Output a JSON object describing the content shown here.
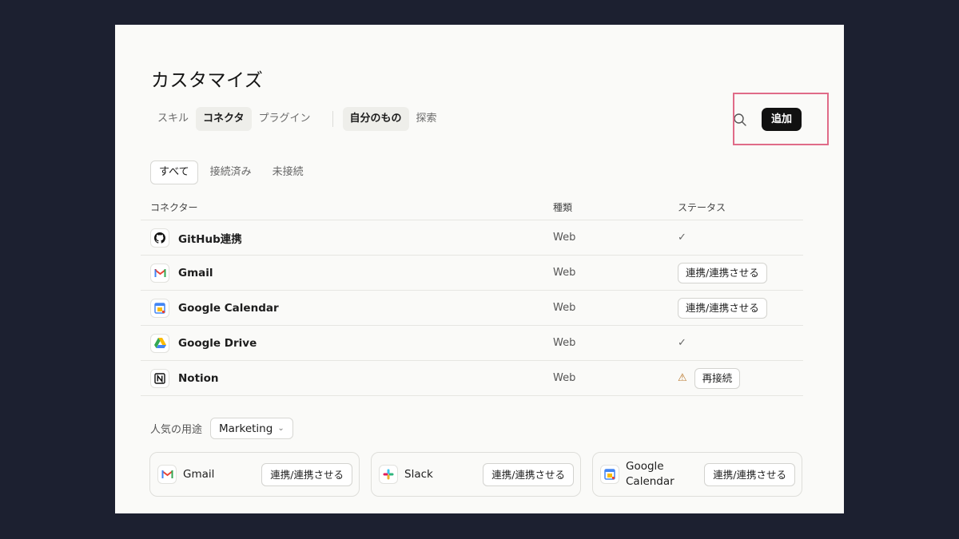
{
  "page": {
    "title": "カスタマイズ",
    "tabs": [
      {
        "label": "スキル",
        "active": false
      },
      {
        "label": "コネクタ",
        "active": true
      },
      {
        "label": "プラグイン",
        "active": false
      }
    ],
    "scope_tabs": [
      {
        "label": "自分のもの",
        "active": true
      },
      {
        "label": "探索",
        "active": false
      }
    ],
    "search_icon": "search-icon",
    "add_label": "追加",
    "highlight_color": "#e06b88"
  },
  "filters": [
    {
      "label": "すべて",
      "active": true
    },
    {
      "label": "接続済み",
      "active": false
    },
    {
      "label": "未接続",
      "active": false
    }
  ],
  "table": {
    "headers": {
      "name": "コネクター",
      "type": "種類",
      "status": "ステータス"
    },
    "rows": [
      {
        "name": "GitHub連携",
        "icon": "github-icon",
        "type": "Web",
        "status": "connected",
        "status_glyph": "✓"
      },
      {
        "name": "Gmail",
        "icon": "gmail-icon",
        "type": "Web",
        "status": "action",
        "action_label": "連携/連携させる"
      },
      {
        "name": "Google Calendar",
        "icon": "google-calendar-icon",
        "type": "Web",
        "status": "action",
        "action_label": "連携/連携させる"
      },
      {
        "name": "Google Drive",
        "icon": "google-drive-icon",
        "type": "Web",
        "status": "connected",
        "status_glyph": "✓"
      },
      {
        "name": "Notion",
        "icon": "notion-icon",
        "type": "Web",
        "status": "warning",
        "warning_glyph": "⚠",
        "action_label": "再接続"
      }
    ]
  },
  "popular": {
    "label": "人気の用途",
    "selected": "Marketing",
    "cards": [
      {
        "name": "Gmail",
        "icon": "gmail-icon",
        "action_label": "連携/連携させる"
      },
      {
        "name": "Slack",
        "icon": "slack-icon",
        "action_label": "連携/連携させる"
      },
      {
        "name": "Google\nCalendar",
        "icon": "google-calendar-icon",
        "action_label": "連携/連携させる"
      }
    ]
  }
}
